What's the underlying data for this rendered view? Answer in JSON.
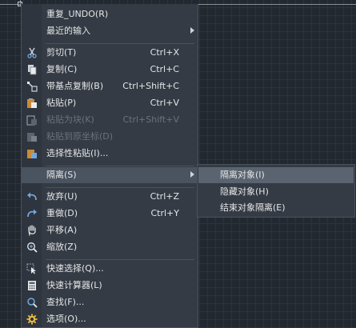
{
  "colors": {
    "background": "#212830",
    "grid": "#2c343d",
    "menu_bg": "#343b45",
    "highlight": "#4a5360",
    "text": "#e6e6e6",
    "disabled_text": "#6b727b"
  },
  "context_menu": {
    "items": [
      {
        "label": "重复_UNDO(R)",
        "shortcut": "",
        "icon": "none"
      },
      {
        "label": "最近的输入",
        "shortcut": "",
        "icon": "none",
        "submenu_arrow": true
      },
      {
        "label": "剪切(T)",
        "shortcut": "Ctrl+X",
        "icon": "scissors-icon"
      },
      {
        "label": "复制(C)",
        "shortcut": "Ctrl+C",
        "icon": "copy-icon"
      },
      {
        "label": "带基点复制(B)",
        "shortcut": "Ctrl+Shift+C",
        "icon": "copy-with-basepoint-icon"
      },
      {
        "label": "粘贴(P)",
        "shortcut": "Ctrl+V",
        "icon": "paste-icon"
      },
      {
        "label": "粘贴为块(K)",
        "shortcut": "Ctrl+Shift+V",
        "icon": "paste-as-block-icon",
        "disabled": true
      },
      {
        "label": "粘贴到原坐标(D)",
        "shortcut": "",
        "icon": "paste-to-original-icon",
        "disabled": true
      },
      {
        "label": "选择性粘贴(I)...",
        "shortcut": "",
        "icon": "paste-special-icon"
      },
      {
        "label": "隔离(S)",
        "shortcut": "",
        "icon": "none",
        "submenu_arrow": true,
        "highlighted": true
      },
      {
        "label": "放弃(U)",
        "shortcut": "Ctrl+Z",
        "icon": "undo-icon"
      },
      {
        "label": "重做(D)",
        "shortcut": "Ctrl+Y",
        "icon": "redo-icon"
      },
      {
        "label": "平移(A)",
        "shortcut": "",
        "icon": "pan-hand-icon"
      },
      {
        "label": "缩放(Z)",
        "shortcut": "",
        "icon": "zoom-icon"
      },
      {
        "label": "快速选择(Q)...",
        "shortcut": "",
        "icon": "quick-select-icon"
      },
      {
        "label": "快速计算器(L)",
        "shortcut": "",
        "icon": "calculator-icon"
      },
      {
        "label": "查找(F)...",
        "shortcut": "",
        "icon": "find-icon"
      },
      {
        "label": "选项(O)...",
        "shortcut": "",
        "icon": "options-gear-icon"
      }
    ]
  },
  "isolate_submenu": {
    "items": [
      {
        "label": "隔离对象(I)",
        "highlighted": true
      },
      {
        "label": "隐藏对象(H)"
      },
      {
        "label": "结束对象隔离(E)"
      }
    ]
  }
}
